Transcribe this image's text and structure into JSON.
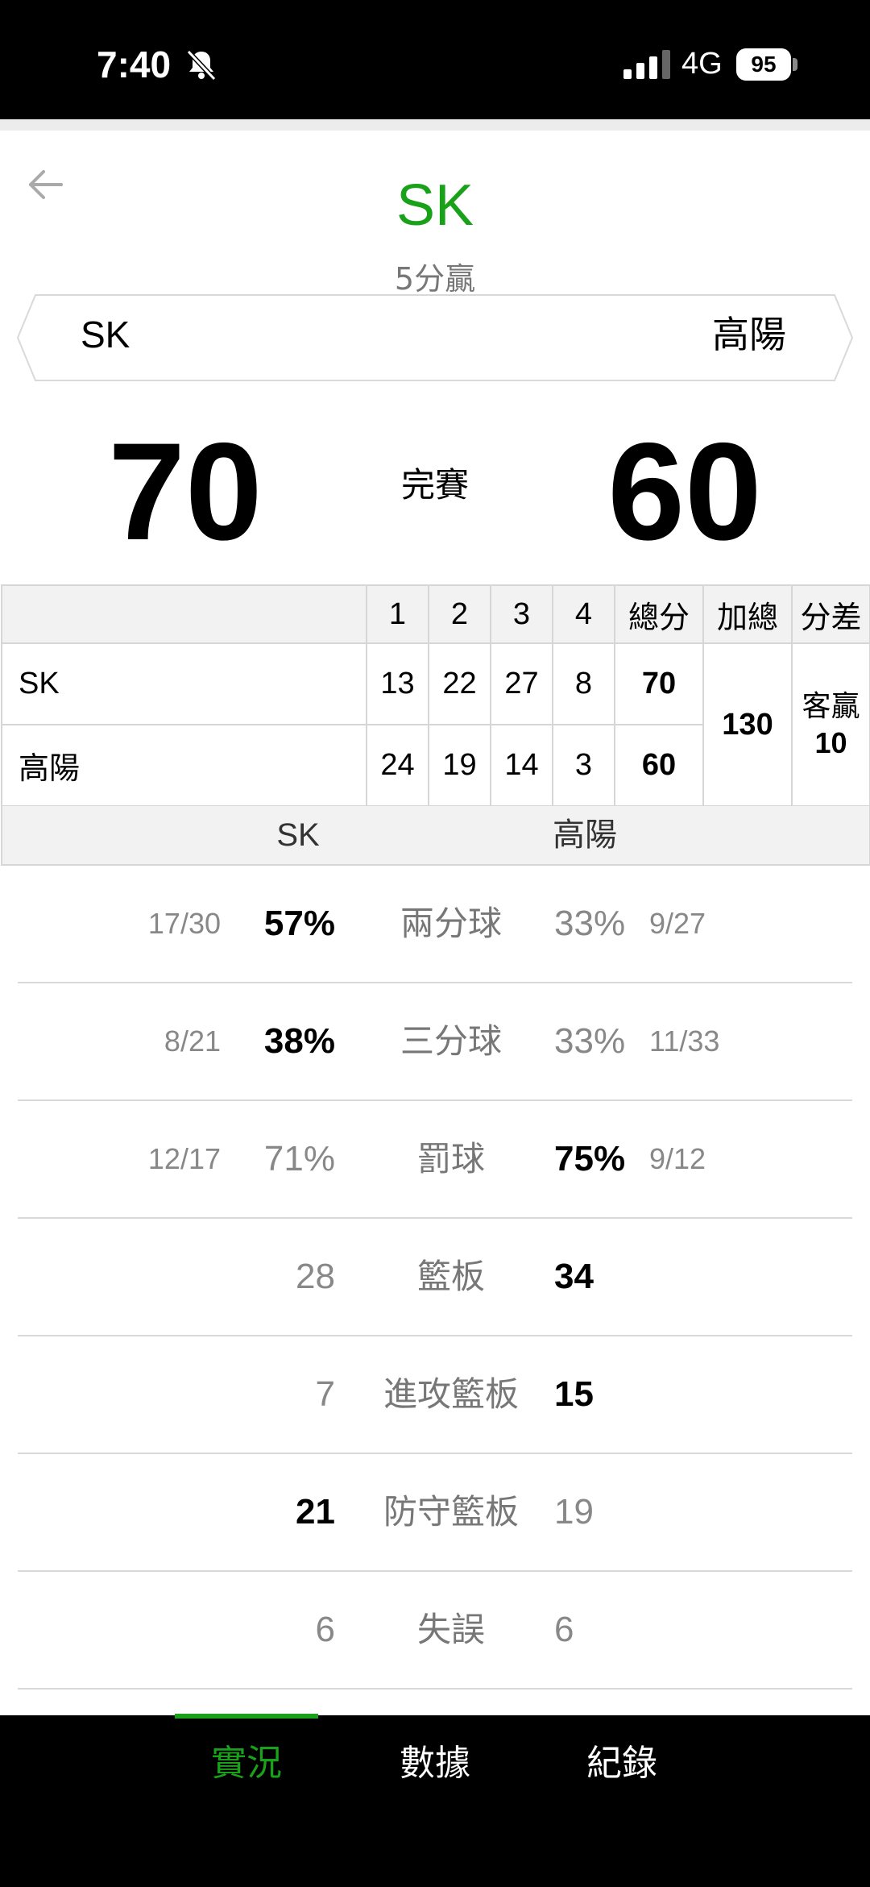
{
  "status_bar": {
    "time": "7:40",
    "network": "4G",
    "battery": "95"
  },
  "header": {
    "title": "SK",
    "subtitle": "5分贏"
  },
  "matchup": {
    "home": "SK",
    "away": "高陽"
  },
  "score": {
    "home": "70",
    "away": "60",
    "status": "完賽"
  },
  "box_score": {
    "columns": [
      "1",
      "2",
      "3",
      "4",
      "總分",
      "加總",
      "分差"
    ],
    "rows": [
      {
        "team": "SK",
        "quarters": [
          "13",
          "22",
          "27",
          "8"
        ],
        "total": "70"
      },
      {
        "team": "高陽",
        "quarters": [
          "24",
          "19",
          "14",
          "3"
        ],
        "total": "60"
      }
    ],
    "sum": "130",
    "diff_label": "客贏",
    "diff_value": "10"
  },
  "stats_header": {
    "home": "SK",
    "away": "高陽"
  },
  "stats": [
    {
      "label": "兩分球",
      "home_frac": "17/30",
      "home": "57%",
      "away": "33%",
      "away_frac": "9/27",
      "leader": "home"
    },
    {
      "label": "三分球",
      "home_frac": "8/21",
      "home": "38%",
      "away": "33%",
      "away_frac": "11/33",
      "leader": "home"
    },
    {
      "label": "罰球",
      "home_frac": "12/17",
      "home": "71%",
      "away": "75%",
      "away_frac": "9/12",
      "leader": "away"
    },
    {
      "label": "籃板",
      "home_frac": "",
      "home": "28",
      "away": "34",
      "away_frac": "",
      "leader": "away"
    },
    {
      "label": "進攻籃板",
      "home_frac": "",
      "home": "7",
      "away": "15",
      "away_frac": "",
      "leader": "away"
    },
    {
      "label": "防守籃板",
      "home_frac": "",
      "home": "21",
      "away": "19",
      "away_frac": "",
      "leader": "home"
    },
    {
      "label": "失誤",
      "home_frac": "",
      "home": "6",
      "away": "6",
      "away_frac": "",
      "leader": "none"
    }
  ],
  "bottom_nav": {
    "tab1": "實況",
    "tab2": "數據",
    "tab3": "紀錄"
  },
  "colors": {
    "accent": "#1aa11a",
    "background": "#ffffff",
    "bar": "#000000"
  }
}
